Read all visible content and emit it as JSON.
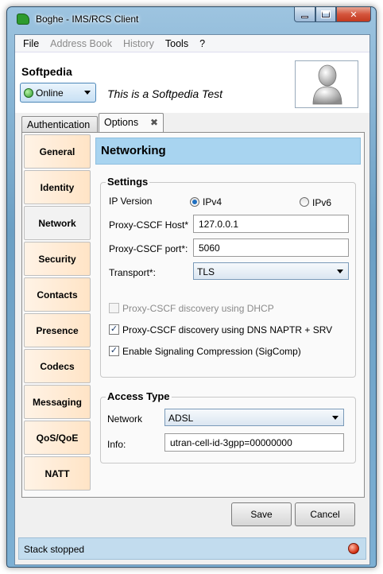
{
  "window": {
    "title": "Boghe - IMS/RCS Client"
  },
  "menu": [
    "File",
    "Address Book",
    "History",
    "Tools",
    "?"
  ],
  "menu_disabled": [
    false,
    true,
    true,
    false,
    false
  ],
  "header": {
    "brand": "Softpedia",
    "presence": "Online",
    "free_text": "This is a Softpedia Test"
  },
  "tabs": [
    {
      "label": "Authentication",
      "active": false
    },
    {
      "label": "Options",
      "active": true,
      "close": "✖"
    }
  ],
  "sidenav": [
    "General",
    "Identity",
    "Network",
    "Security",
    "Contacts",
    "Presence",
    "Codecs",
    "Messaging",
    "QoS/QoE",
    "NATT"
  ],
  "sidenav_active": "Network",
  "networking": {
    "title": "Networking",
    "settings": {
      "title": "Settings",
      "ip_version_label": "IP Version",
      "ipv4_label": "IPv4",
      "ipv6_label": "IPv6",
      "ip_selected": "IPv4",
      "host_label": "Proxy-CSCF Host*",
      "host_value": "127.0.0.1",
      "port_label": "Proxy-CSCF port*:",
      "port_value": "5060",
      "transport_label": "Transport*:",
      "transport_value": "TLS",
      "dhcp_label": "Proxy-CSCF discovery using DHCP",
      "dhcp_checked": false,
      "naptr_label": "Proxy-CSCF discovery using DNS NAPTR + SRV",
      "naptr_checked": true,
      "sigcomp_label": "Enable Signaling Compression (SigComp)",
      "sigcomp_checked": true
    },
    "access": {
      "title": "Access Type",
      "network_label": "Network",
      "network_value": "ADSL",
      "info_label": "Info:",
      "info_value": "utran-cell-id-3gpp=00000000"
    }
  },
  "buttons": {
    "save": "Save",
    "cancel": "Cancel"
  },
  "status": {
    "text": "Stack stopped"
  },
  "colors": {
    "nav_bg": "#ffe4c6",
    "section_header": "#a8d4f0",
    "statusbar": "#c2dcee",
    "status_led": "#d02a0c"
  }
}
